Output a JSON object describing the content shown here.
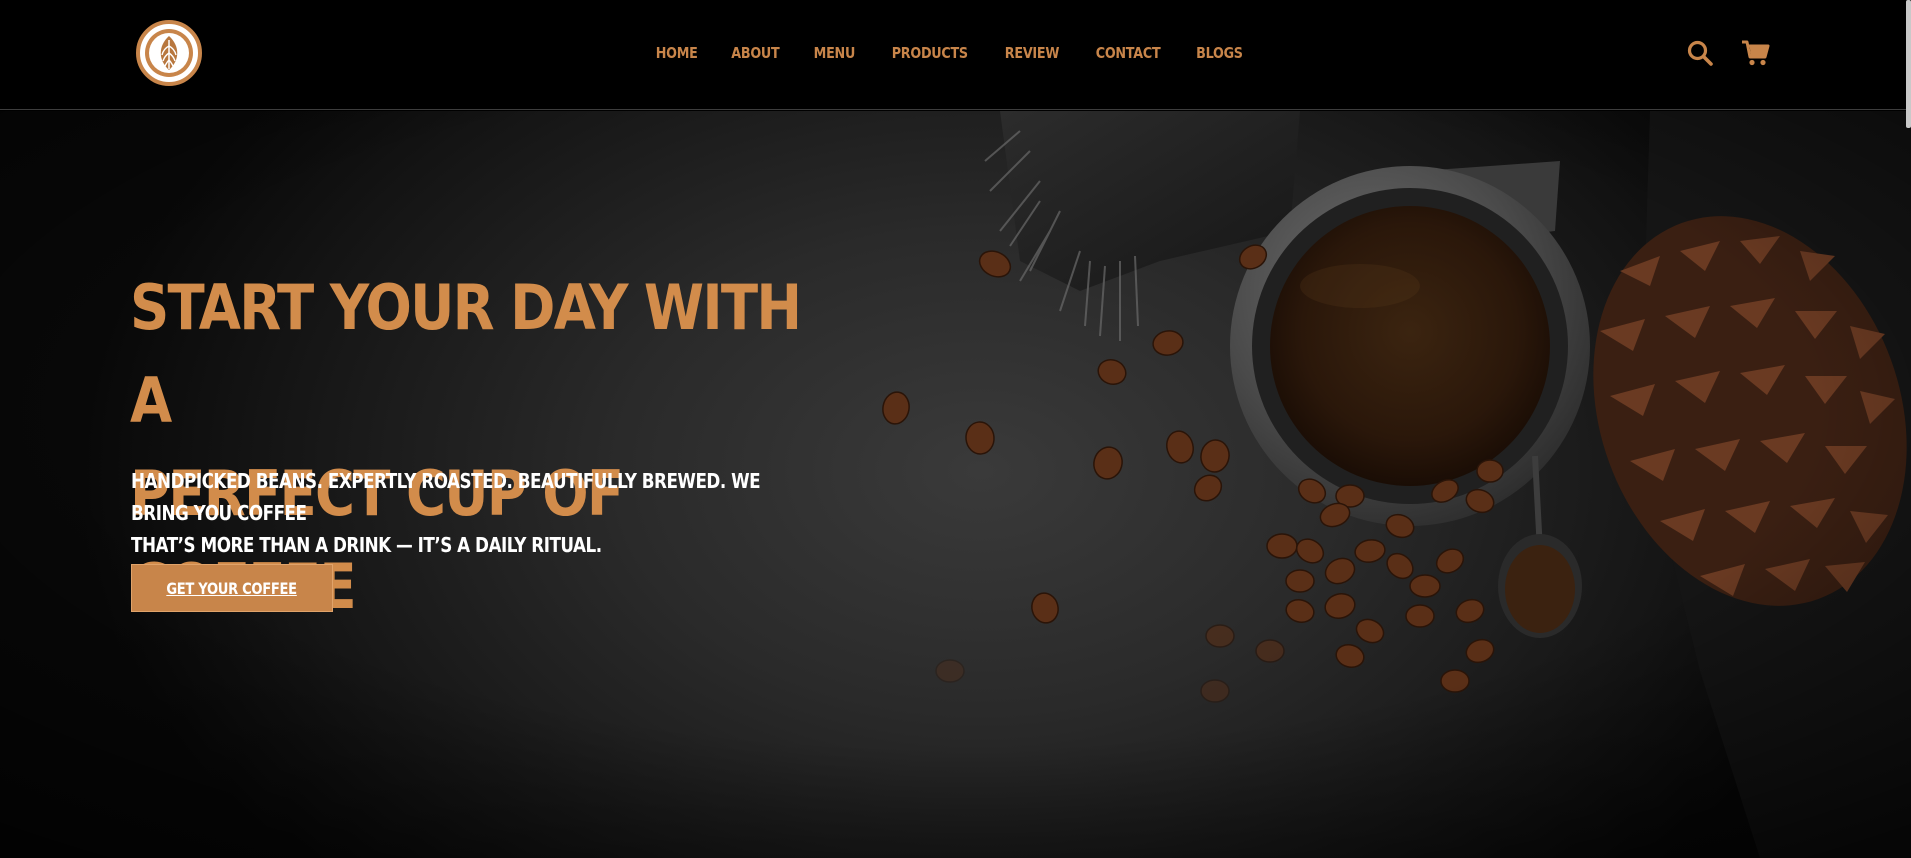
{
  "header": {
    "logo_icon": "latte-art-leaf-icon",
    "nav": [
      {
        "label": "HOME"
      },
      {
        "label": "ABOUT"
      },
      {
        "label": "MENU"
      },
      {
        "label": "PRODUCTS"
      },
      {
        "label": "REVIEW"
      },
      {
        "label": "CONTACT"
      },
      {
        "label": "BLOGS"
      }
    ],
    "search_icon": "search-icon",
    "cart_icon": "cart-icon"
  },
  "hero": {
    "title_line1": "START YOUR DAY WITH A",
    "title_line2": "PERFECT CUP OF COFFEE",
    "subtitle_line1": "HANDPICKED BEANS. EXPERTLY ROASTED. BEAUTIFULLY BREWED. WE BRING YOU COFFEE",
    "subtitle_line2": "THAT’S MORE THAN A DRINK — IT’S A DAILY RITUAL.",
    "cta_label": "GET YOUR COFFEE"
  },
  "colors": {
    "accent": "#c8854a",
    "title": "#d28c4b",
    "background": "#000000",
    "text": "#ffffff"
  }
}
